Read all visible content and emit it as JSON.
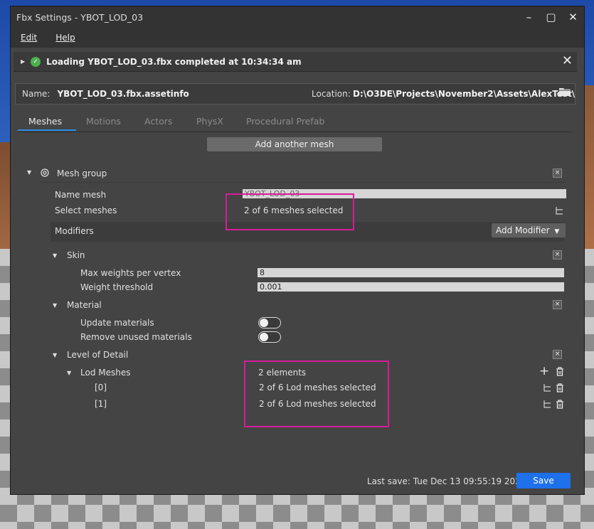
{
  "window": {
    "title": "Fbx Settings - YBOT_LOD_03",
    "controls": [
      "minimize-icon",
      "maximize-icon",
      "close-icon"
    ]
  },
  "menu": {
    "edit": "Edit",
    "help": "Help"
  },
  "notification": {
    "message": "Loading YBOT_LOD_03.fbx completed at 10:34:34 am",
    "status_color": "#4caf50"
  },
  "file": {
    "name_label": "Name:",
    "name_value": "YBOT_LOD_03.fbx.assetinfo",
    "location_label": "Location:",
    "location_value": "D:\\O3DE\\Projects\\November2\\Assets\\AlexTest\\"
  },
  "tabs": [
    {
      "label": "Meshes",
      "active": true
    },
    {
      "label": "Motions",
      "active": false
    },
    {
      "label": "Actors",
      "active": false
    },
    {
      "label": "PhysX",
      "active": false
    },
    {
      "label": "Procedural Prefab",
      "active": false
    }
  ],
  "add_mesh_label": "Add another mesh",
  "mesh_group": {
    "title": "Mesh group",
    "name_mesh_label": "Name mesh",
    "name_mesh_value": "YBOT_LOD_03",
    "select_meshes_label": "Select meshes",
    "select_meshes_value": "2 of 6 meshes selected",
    "modifiers_label": "Modifiers",
    "add_modifier_label": "Add Modifier"
  },
  "skin": {
    "title": "Skin",
    "max_weights_label": "Max weights per vertex",
    "max_weights_value": "8",
    "weight_threshold_label": "Weight threshold",
    "weight_threshold_value": "0.001"
  },
  "material": {
    "title": "Material",
    "update_label": "Update materials",
    "remove_label": "Remove unused materials"
  },
  "lod": {
    "title": "Level of Detail",
    "lod_meshes_label": "Lod Meshes",
    "lod_meshes_value": "2 elements",
    "items": [
      {
        "label": "[0]",
        "value": "2 of 6 Lod meshes selected"
      },
      {
        "label": "[1]",
        "value": "2 of 6 Lod meshes selected"
      }
    ]
  },
  "footer": {
    "last_save": "Last save:  Tue Dec 13 09:55:19 2022",
    "save_label": "Save"
  },
  "colors": {
    "accent": "#1e70eb",
    "highlight": "#d81b9a"
  }
}
